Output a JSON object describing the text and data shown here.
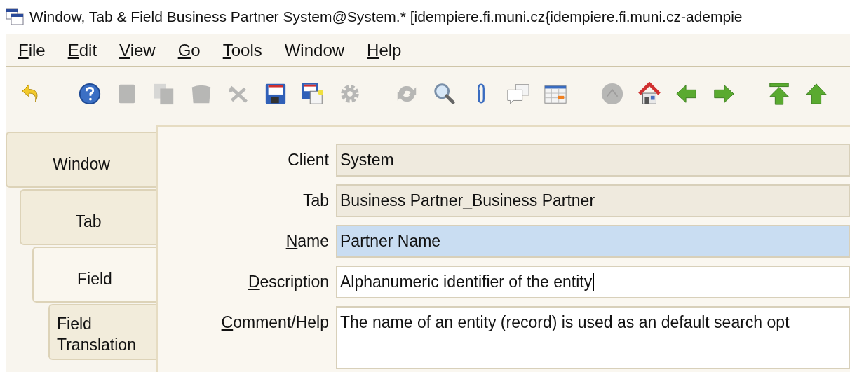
{
  "window": {
    "title": "Window, Tab & Field  Business Partner  System@System.* [idempiere.fi.muni.cz{idempiere.fi.muni.cz-adempie"
  },
  "menu": [
    {
      "label": "File",
      "mnemonic": true
    },
    {
      "label": "Edit",
      "mnemonic": true
    },
    {
      "label": "View",
      "mnemonic": true
    },
    {
      "label": "Go",
      "mnemonic": true
    },
    {
      "label": "Tools",
      "mnemonic": true
    },
    {
      "label": "Window",
      "mnemonic": false
    },
    {
      "label": "Help",
      "mnemonic": true
    }
  ],
  "toolbar": [
    {
      "kind": "undo",
      "disabled": false
    },
    {
      "kind": "help",
      "disabled": false
    },
    {
      "kind": "new",
      "disabled": true
    },
    {
      "kind": "copy",
      "disabled": true
    },
    {
      "kind": "delete",
      "disabled": true
    },
    {
      "kind": "delete-selection",
      "disabled": true
    },
    {
      "kind": "save",
      "disabled": false
    },
    {
      "kind": "save-create",
      "disabled": false
    },
    {
      "kind": "process",
      "disabled": true
    },
    {
      "kind": "refresh",
      "disabled": true
    },
    {
      "kind": "find",
      "disabled": false
    },
    {
      "kind": "attachment",
      "disabled": false
    },
    {
      "kind": "chat",
      "disabled": false
    },
    {
      "kind": "grid",
      "disabled": false
    },
    {
      "kind": "archive",
      "disabled": true
    },
    {
      "kind": "home",
      "disabled": false
    },
    {
      "kind": "previous",
      "disabled": false
    },
    {
      "kind": "next",
      "disabled": false
    },
    {
      "kind": "first",
      "disabled": false
    },
    {
      "kind": "up",
      "disabled": false
    }
  ],
  "tabs": [
    {
      "label": "Window",
      "selected": false
    },
    {
      "label": "Tab",
      "selected": false
    },
    {
      "label": "Field",
      "selected": true
    },
    {
      "label": "Field Translation",
      "selected": false
    }
  ],
  "fields": [
    {
      "label": "Client",
      "mnemonic": false,
      "value": "System",
      "kind": "readonly",
      "highlighted": false,
      "focused": false
    },
    {
      "label": "Tab",
      "mnemonic": false,
      "value": "Business Partner_Business Partner",
      "kind": "readonly",
      "highlighted": false,
      "focused": false
    },
    {
      "label": "Name",
      "mnemonic": true,
      "value": "Partner Name",
      "kind": "text",
      "highlighted": true,
      "focused": false
    },
    {
      "label": "Description",
      "mnemonic": true,
      "value": "Alphanumeric identifier of the entity",
      "kind": "text",
      "highlighted": false,
      "focused": true
    },
    {
      "label": "Comment/Help",
      "mnemonic": true,
      "value": "The name of an entity (record) is used as an default search opt",
      "kind": "textarea",
      "highlighted": false,
      "focused": false
    }
  ]
}
